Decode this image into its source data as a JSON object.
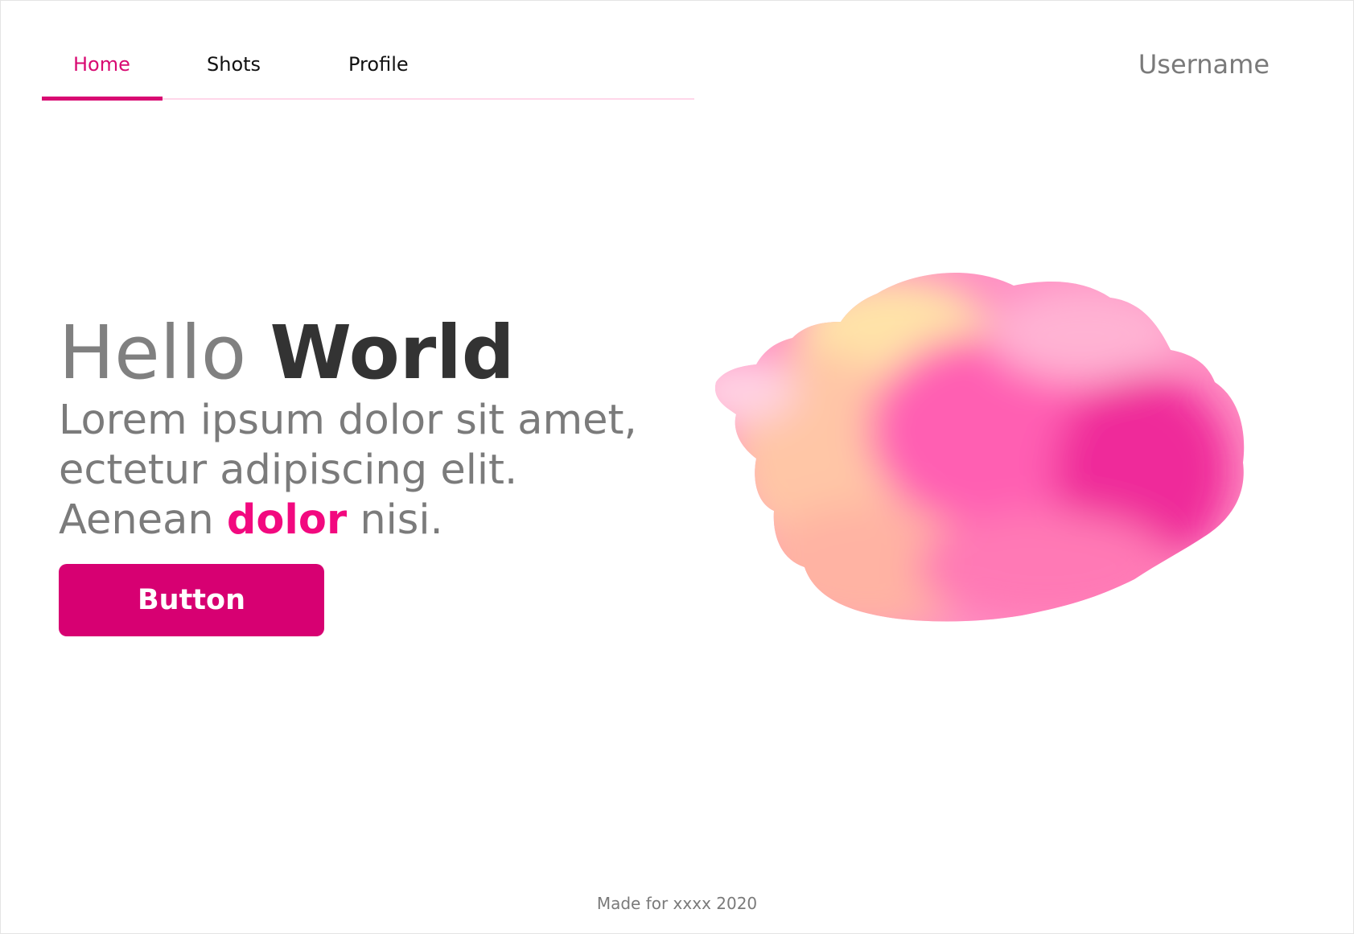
{
  "nav": {
    "items": [
      {
        "label": "Home",
        "active": true
      },
      {
        "label": "Shots",
        "active": false
      },
      {
        "label": "Profile",
        "active": false
      }
    ],
    "username": "Username"
  },
  "hero": {
    "title_light": "Hello",
    "title_bold": "World",
    "line1": "Lorem ipsum dolor sit amet,",
    "line2": "ectetur adipiscing elit.",
    "line3_start": "Aenean",
    "line3_accent": "dolor",
    "line3_end": "nisi.",
    "button_label": "Button"
  },
  "footer": {
    "text": "Made for xxxx 2020"
  },
  "colors": {
    "accent": "#d80a72",
    "accent_bright": "#f2097f",
    "nav_track": "#ffd7ea",
    "muted_text": "#7b7b7b",
    "dark_text": "#333333"
  }
}
